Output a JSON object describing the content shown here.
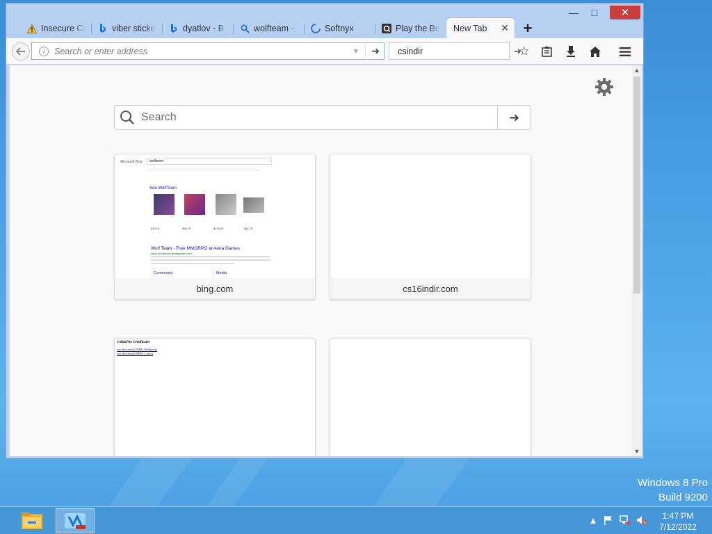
{
  "browser": {
    "tabs": [
      {
        "label": "Insecure Co",
        "icon": "warning-icon"
      },
      {
        "label": "viber sticke",
        "icon": "bing-icon"
      },
      {
        "label": "dyatlov - B",
        "icon": "bing-icon"
      },
      {
        "label": "wolfteam -",
        "icon": "search-icon"
      },
      {
        "label": "Softnyx",
        "icon": "loading-icon"
      },
      {
        "label": "Play the Be",
        "icon": "game-icon"
      },
      {
        "label": "New Tab",
        "icon": "none"
      }
    ],
    "new_tab_symbol": "+",
    "url_placeholder": "Search or enter address",
    "url_value": "",
    "search_value": "csindir"
  },
  "newtab": {
    "search_placeholder": "Search",
    "tiles": [
      {
        "label": "bing.com",
        "has_thumb": true
      },
      {
        "label": "cs16indir.com",
        "has_thumb": false
      }
    ],
    "bing_thumb": {
      "brand": "Microsoft Bing",
      "query": "wolfteam",
      "section": "See WolfTeam",
      "prices": [
        "$33.16",
        "$36.75",
        "$128.00",
        "$42.78"
      ],
      "result_title": "Wolf Team - Free MMORPG at Aeria Games",
      "result_url": "https://wolfteam.aeriagames.com",
      "links": [
        "Community",
        "Media"
      ]
    },
    "cert_thumb": {
      "title": "CollabNet Certificates",
      "links": [
        "cert download (DER, Windows)",
        "cert download (PEM, Linux)"
      ]
    }
  },
  "os": {
    "watermark_line1": "Windows 8 Pro",
    "watermark_line2": "Build 9200",
    "time": "1:47 PM",
    "date": "7/12/2022"
  }
}
